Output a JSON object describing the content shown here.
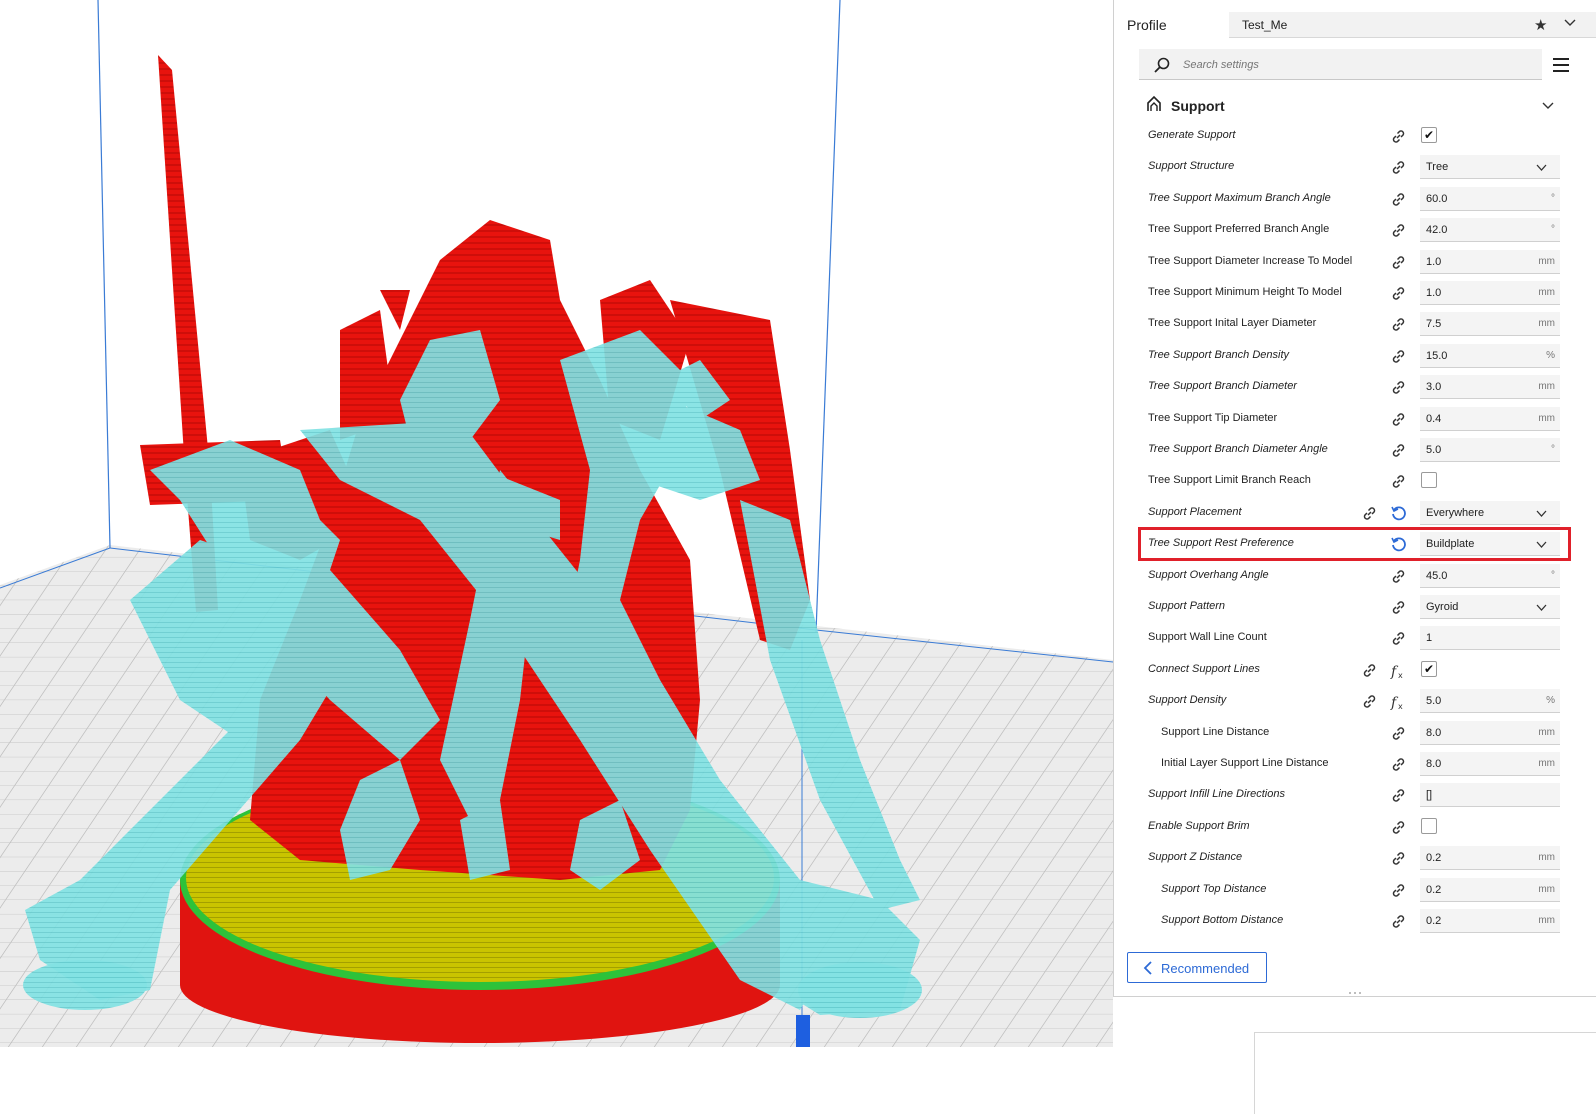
{
  "profile": {
    "label": "Profile",
    "value": "Test_Me"
  },
  "search": {
    "placeholder": "Search settings"
  },
  "section": {
    "title": "Support"
  },
  "settings": [
    {
      "label": "Generate Support",
      "italic": true,
      "indent": 0,
      "type": "checkbox",
      "checked": true
    },
    {
      "label": "Support Structure",
      "italic": true,
      "indent": 0,
      "type": "dropdown",
      "value": "Tree"
    },
    {
      "label": "Tree Support Maximum Branch Angle",
      "italic": true,
      "indent": 0,
      "type": "number",
      "value": "60.0",
      "unit": "°"
    },
    {
      "label": "Tree Support Preferred Branch Angle",
      "italic": false,
      "indent": 0,
      "type": "number",
      "value": "42.0",
      "unit": "°"
    },
    {
      "label": "Tree Support Diameter Increase To Model",
      "italic": false,
      "indent": 0,
      "type": "number",
      "value": "1.0",
      "unit": "mm"
    },
    {
      "label": "Tree Support Minimum Height To Model",
      "italic": false,
      "indent": 0,
      "type": "number",
      "value": "1.0",
      "unit": "mm"
    },
    {
      "label": "Tree Support Inital Layer Diameter",
      "italic": false,
      "indent": 0,
      "type": "number",
      "value": "7.5",
      "unit": "mm"
    },
    {
      "label": "Tree Support Branch Density",
      "italic": true,
      "indent": 0,
      "type": "number",
      "value": "15.0",
      "unit": "%"
    },
    {
      "label": "Tree Support Branch Diameter",
      "italic": true,
      "indent": 0,
      "type": "number",
      "value": "3.0",
      "unit": "mm"
    },
    {
      "label": "Tree Support Tip Diameter",
      "italic": false,
      "indent": 0,
      "type": "number",
      "value": "0.4",
      "unit": "mm"
    },
    {
      "label": "Tree Support Branch Diameter Angle",
      "italic": true,
      "indent": 0,
      "type": "number",
      "value": "5.0",
      "unit": "°"
    },
    {
      "label": "Tree Support Limit Branch Reach",
      "italic": false,
      "indent": 0,
      "type": "checkbox",
      "checked": false
    },
    {
      "label": "Support Placement",
      "italic": true,
      "indent": 0,
      "type": "dropdown",
      "value": "Everywhere",
      "extra": "reset",
      "link": true
    },
    {
      "label": "Tree Support Rest Preference",
      "italic": true,
      "indent": 0,
      "type": "dropdown",
      "value": "Buildplate",
      "extra": "reset",
      "link": false
    },
    {
      "label": "Support Overhang Angle",
      "italic": true,
      "indent": 0,
      "type": "number",
      "value": "45.0",
      "unit": "°"
    },
    {
      "label": "Support Pattern",
      "italic": true,
      "indent": 0,
      "type": "dropdown",
      "value": "Gyroid"
    },
    {
      "label": "Support Wall Line Count",
      "italic": false,
      "indent": 0,
      "type": "number",
      "value": "1",
      "unit": ""
    },
    {
      "label": "Connect Support Lines",
      "italic": true,
      "indent": 0,
      "type": "checkbox",
      "checked": true,
      "extra": "fx",
      "link": true
    },
    {
      "label": "Support Density",
      "italic": true,
      "indent": 0,
      "type": "number",
      "value": "5.0",
      "unit": "%",
      "extra": "fx",
      "link": true
    },
    {
      "label": "Support Line Distance",
      "italic": false,
      "indent": 1,
      "type": "number",
      "value": "8.0",
      "unit": "mm"
    },
    {
      "label": "Initial Layer Support Line Distance",
      "italic": false,
      "indent": 1,
      "type": "number",
      "value": "8.0",
      "unit": "mm"
    },
    {
      "label": "Support Infill Line Directions",
      "italic": true,
      "indent": 0,
      "type": "text",
      "value": "[]"
    },
    {
      "label": "Enable Support Brim",
      "italic": true,
      "indent": 0,
      "type": "checkbox",
      "checked": false
    },
    {
      "label": "Support Z Distance",
      "italic": true,
      "indent": 0,
      "type": "number",
      "value": "0.2",
      "unit": "mm"
    },
    {
      "label": "Support Top Distance",
      "italic": true,
      "indent": 1,
      "type": "number",
      "value": "0.2",
      "unit": "mm"
    },
    {
      "label": "Support Bottom Distance",
      "italic": true,
      "indent": 1,
      "type": "number",
      "value": "0.2",
      "unit": "mm"
    }
  ],
  "footer": {
    "recommended_label": "Recommended"
  },
  "colors": {
    "accent": "#2d6ad6",
    "model": "#e8130e",
    "support": "#80e2e2",
    "raft": "#c8c400",
    "highlight": "#e0202a"
  },
  "icons": [
    "search-icon",
    "menu-icon",
    "support-icon",
    "link-icon",
    "reset-icon",
    "fx-icon",
    "star-icon",
    "chevron-down-icon",
    "chevron-left-icon"
  ]
}
